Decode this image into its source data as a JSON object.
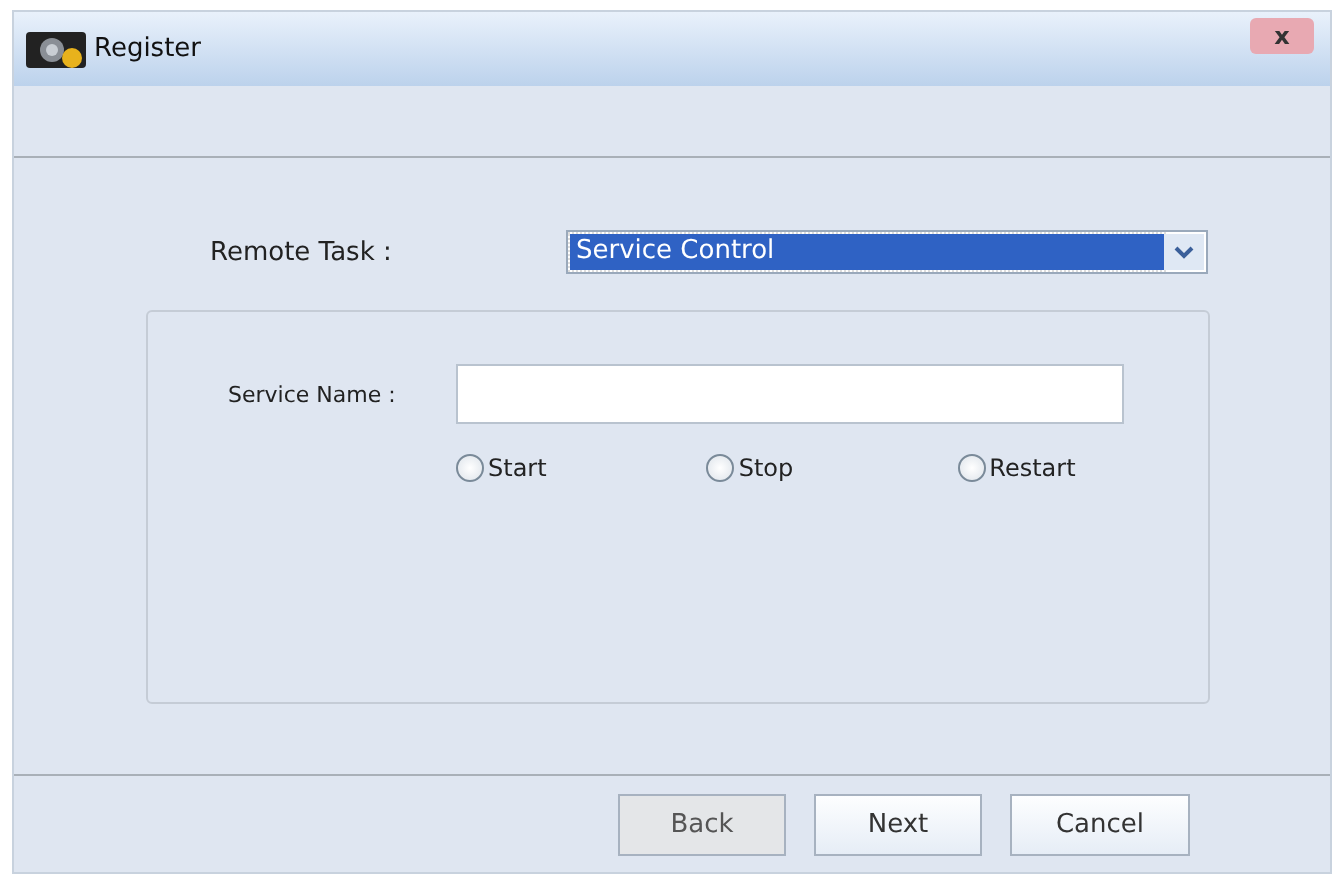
{
  "window": {
    "title": "Register",
    "close": "x"
  },
  "remote_task": {
    "label": "Remote Task :",
    "value": "Service Control"
  },
  "service_name": {
    "label": "Service Name :"
  },
  "actions": [
    {
      "label": "Start",
      "selected": false
    },
    {
      "label": "Stop",
      "selected": false
    },
    {
      "label": "Restart",
      "selected": false
    }
  ],
  "buttons": [
    {
      "label": "Back",
      "disabled": true
    },
    {
      "label": "Next",
      "disabled": false
    },
    {
      "label": "Cancel",
      "disabled": false
    }
  ]
}
